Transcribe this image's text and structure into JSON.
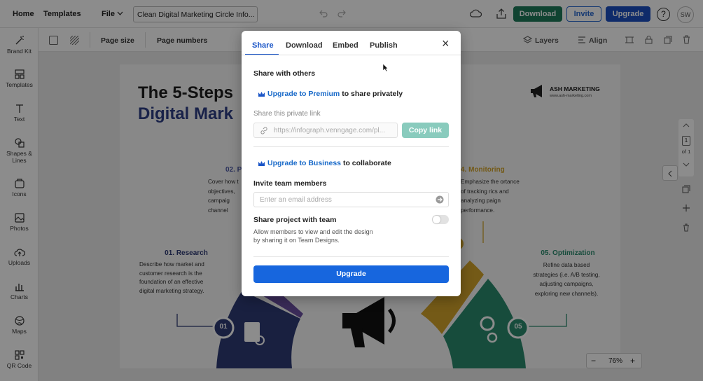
{
  "topbar": {
    "home": "Home",
    "templates": "Templates",
    "file": "File",
    "doc_title": "Clean Digital Marketing Circle Info...",
    "download": "Download",
    "invite": "Invite",
    "upgrade": "Upgrade",
    "help": "?",
    "avatar": "SW"
  },
  "sidebar": {
    "items": [
      {
        "label": "Brand Kit",
        "icon": "wand-icon"
      },
      {
        "label": "Templates",
        "icon": "templates-icon"
      },
      {
        "label": "Text",
        "icon": "text-icon"
      },
      {
        "label": "Shapes &\nLines",
        "icon": "shapes-icon"
      },
      {
        "label": "Icons",
        "icon": "icons-icon"
      },
      {
        "label": "Photos",
        "icon": "photo-icon"
      },
      {
        "label": "Uploads",
        "icon": "upload-icon"
      },
      {
        "label": "Charts",
        "icon": "chart-icon"
      },
      {
        "label": "Maps",
        "icon": "map-icon"
      },
      {
        "label": "QR Code",
        "icon": "qr-icon"
      }
    ]
  },
  "toolbar": {
    "page_size": "Page size",
    "page_numbers": "Page numbers",
    "layers": "Layers",
    "align": "Align"
  },
  "pager": {
    "current": "1",
    "of": "of 1"
  },
  "zoom": {
    "minus": "−",
    "value": "76%",
    "plus": "+"
  },
  "artboard": {
    "title_line1": "The 5-Steps",
    "title_line2": "Digital Mark",
    "brand_name": "ASH MARKETING",
    "brand_url": "www.ash-marketing.com",
    "step1_title": "01. Research",
    "step1_text": "Describe how market and customer research is the foundation of an effective digital marketing strategy.",
    "step2_title": "02. P",
    "step2_text": "Cover how t objectives, campaig channel",
    "step4_title": "4. Monitoring",
    "step4_text": "Emphasize the ortance of tracking rics and analyzing paign performance.",
    "step5_title": "05. Optimization",
    "step5_text": "Refine data based strategies (i.e. A/B testing, adjusting campaigns, exploring new channels).",
    "badge1": "01",
    "badge5": "05",
    "colors": {
      "navy": "#2f3b75",
      "purple": "#6a4fa0",
      "gold": "#d4a52b",
      "green": "#2a8b6e"
    }
  },
  "modal": {
    "tabs": [
      "Share",
      "Download",
      "Embed",
      "Publish"
    ],
    "active_tab": "Share",
    "close": "×",
    "share_heading": "Share with others",
    "premium_link": "Upgrade to Premium",
    "premium_rest": " to share privately",
    "private_link_label": "Share this private link",
    "link_value": "https://infograph.venngage.com/pl...",
    "copy_link": "Copy link",
    "business_link": "Upgrade to Business",
    "business_rest": " to collaborate",
    "invite_heading": "Invite team members",
    "email_placeholder": "Enter an email address",
    "team_heading": "Share project with team",
    "team_desc_1": "Allow members to view and edit the design",
    "team_desc_2": "by sharing it on Team Designs.",
    "upgrade_button": "Upgrade"
  }
}
